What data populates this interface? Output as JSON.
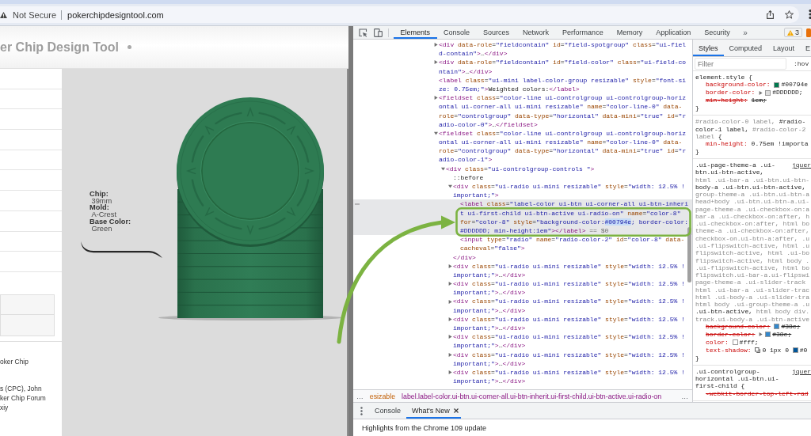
{
  "browser": {
    "security_label": "Not Secure",
    "url": "pokerchipdesigntool.com"
  },
  "page": {
    "title": "er Chip Design Tool",
    "spec": [
      {
        "label": "Chip:",
        "value": "39mm"
      },
      {
        "label": "Mold:",
        "value": "A-Crest"
      },
      {
        "label": "Base Color:",
        "value": "Green"
      }
    ],
    "credits": [
      "oker Chip",
      "s (CPC), John\nker Chip Forum\nxiy"
    ]
  },
  "devtools": {
    "tabs": [
      {
        "label": "Elements",
        "selected": true
      },
      {
        "label": "Console",
        "selected": false
      },
      {
        "label": "Sources",
        "selected": false
      },
      {
        "label": "Network",
        "selected": false
      },
      {
        "label": "Performance",
        "selected": false
      },
      {
        "label": "Memory",
        "selected": false
      },
      {
        "label": "Application",
        "selected": false
      },
      {
        "label": "Security",
        "selected": false
      }
    ],
    "more_tabs": "»",
    "issues_count": "3",
    "elements": {
      "tree": [
        {
          "lines": [
            "<div data-role=\"fieldcontain\" id=\"field-spotgroup\" class=\"ui-fiel",
            "d-contain\">…</div>"
          ],
          "expanded": false,
          "selected": false
        },
        {
          "lines": [
            "<div data-role=\"fieldcontain\" id=\"field-color\" class=\"ui-field-co",
            "ntain\">…</div>"
          ],
          "expanded": false,
          "selected": false
        },
        {
          "lines": [
            "<label class=\"ui-mini label-color-group resizable\" style=\"font-si",
            "ze: 0.75em;\">Weighted colors:</label>"
          ],
          "selected": false
        },
        {
          "lines": [
            "<fieldset class=\"color-line ui-controlgroup ui-controlgroup-horiz",
            "ontal ui-corner-all ui-mini resizable\" name=\"color-line-0\" data-",
            "role=\"controlgroup\" data-type=\"horizontal\" data-mini=\"true\" id=\"r",
            "adio-color-0\">…</fieldset>"
          ],
          "expanded": false,
          "selected": false
        },
        {
          "lines": [
            "<fieldset class=\"color-line ui-controlgroup ui-controlgroup-horiz",
            "ontal ui-corner-all ui-mini resizable\" name=\"color-line-0\" data-",
            "role=\"controlgroup\" data-type=\"horizontal\" data-mini=\"true\" id=\"r",
            "adio-color-1\">"
          ],
          "expanded": true,
          "selected": false,
          "children": [
            {
              "lines": [
                "<div class=\"ui-controlgroup-controls \">"
              ],
              "expanded": true,
              "selected": false,
              "children": [
                {
                  "lines": [
                    "::before"
                  ],
                  "selected": false
                },
                {
                  "lines": [
                    "<div class=\"ui-radio ui-mini resizable\" style=\"width: 12.5% !",
                    "important;\">"
                  ],
                  "expanded": true,
                  "selected": false,
                  "closing": "</div>",
                  "children": [
                    {
                      "lines": [
                        "<label class=\"label-color ui-btn ui-corner-all ui-btn-inheri",
                        "t ui-first-child ui-btn-active ui-radio-on\" name=\"color-8\"",
                        {
                          "before": "for=\"color-8\" style=\"background-color:",
                          "selection": "#00794e",
                          "after": "; border-color:"
                        },
                        "#DDDDDD; min-height:1em\"></label>"
                      ],
                      "suffix": "== $0",
                      "selected": true
                    },
                    {
                      "lines": [
                        "<input type=\"radio\" name=\"radio-color-2\" id=\"color-8\" data-",
                        "cacheval=\"false\">"
                      ],
                      "selected": false
                    }
                  ]
                },
                {
                  "lines": [
                    "<div class=\"ui-radio ui-mini resizable\" style=\"width: 12.5% !",
                    "important;\">…</div>"
                  ],
                  "expanded": false,
                  "selected": false
                },
                {
                  "lines": [
                    "<div class=\"ui-radio ui-mini resizable\" style=\"width: 12.5% !",
                    "important;\">…</div>"
                  ],
                  "expanded": false,
                  "selected": false
                },
                {
                  "lines": [
                    "<div class=\"ui-radio ui-mini resizable\" style=\"width: 12.5% !",
                    "important;\">…</div>"
                  ],
                  "expanded": false,
                  "selected": false
                },
                {
                  "lines": [
                    "<div class=\"ui-radio ui-mini resizable\" style=\"width: 12.5% !",
                    "important;\">…</div>"
                  ],
                  "expanded": false,
                  "selected": false
                },
                {
                  "lines": [
                    "<div class=\"ui-radio ui-mini resizable\" style=\"width: 12.5% !",
                    "important;\">…</div>"
                  ],
                  "expanded": false,
                  "selected": false
                },
                {
                  "lines": [
                    "<div class=\"ui-radio ui-mini resizable\" style=\"width: 12.5% !",
                    "important;\">…</div>"
                  ],
                  "expanded": false,
                  "selected": false
                },
                {
                  "lines": [
                    "<div class=\"ui-radio ui-mini resizable\" style=\"width: 12.5% !",
                    "important;\">…</div>"
                  ],
                  "expanded": false,
                  "selected": false
                }
              ]
            }
          ]
        }
      ]
    },
    "breadcrumbs": {
      "scroll_left": "…",
      "items": [
        {
          "text": "esizable",
          "selected": false
        },
        {
          "text": "label.label-color.ui-btn.ui-corner-all.ui-btn-inherit.ui-first-child.ui-btn-active.ui-radio-on",
          "selected": true
        }
      ],
      "scroll_right": "…"
    },
    "styles": {
      "tabs": [
        {
          "label": "Styles",
          "selected": true
        },
        {
          "label": "Computed",
          "selected": false
        },
        {
          "label": "Layout",
          "selected": false
        },
        {
          "label": "E",
          "selected": false
        }
      ],
      "filter": {
        "placeholder": "Filter"
      },
      "state_toggle": ":hov",
      "rules": [
        {
          "selector_lines": [
            [
              {
                "text": "element.style {",
                "matched": true
              }
            ]
          ],
          "declarations": [
            {
              "name": "background-color:",
              "kind": "color",
              "color": "#00794e",
              "value": "#00794e",
              "struck": false
            },
            {
              "name": "border-color:",
              "kind": "color",
              "expanded": false,
              "color": "#dddddd",
              "value": "#DDDDDD;",
              "struck": false
            },
            {
              "name": "min-height:",
              "kind": "plain",
              "value": "1em;",
              "struck": true
            }
          ],
          "closing": "}"
        },
        {
          "selector_lines": [
            [
              {
                "text": "#radio-color-0 label,",
                "matched": false
              },
              {
                "text": " #radio-",
                "matched": true
              }
            ],
            [
              {
                "text": "color-1 label,",
                "matched": true
              },
              {
                "text": " #radio-color-2",
                "matched": false
              }
            ],
            [
              {
                "text": "label",
                "matched": false
              },
              {
                "text": " {",
                "matched": true
              }
            ]
          ],
          "declarations": [
            {
              "name": "min-height:",
              "kind": "plain",
              "value": "0.75em !importa",
              "struck": false
            }
          ],
          "closing": "}"
        },
        {
          "selector_lines": [
            [
              {
                "text": ".ui-page-theme-a .ui-",
                "matched": true
              }
            ],
            [
              {
                "text": "btn.ui-btn-active,",
                "matched": true
              }
            ],
            [
              {
                "text": "html .ui-bar-a .ui-btn.ui-btn-",
                "matched": false
              }
            ],
            [
              {
                "text": "body-a .ui-btn.ui-btn-active,",
                "matched": true
              }
            ],
            [
              {
                "text": "group-theme-a .ui-btn.ui-btn-a",
                "matched": false
              }
            ],
            [
              {
                "text": "head+body .ui-btn.ui-btn-a.ui-",
                "matched": false
              }
            ],
            [
              {
                "text": "page-theme-a .ui-checkbox-on:a",
                "matched": false
              }
            ],
            [
              {
                "text": "bar-a .ui-checkbox-on:after, h",
                "matched": false
              }
            ],
            [
              {
                "text": ".ui-checkbox-on:after, html bo",
                "matched": false
              }
            ],
            [
              {
                "text": "theme-a .ui-checkbox-on:after,",
                "matched": false
              }
            ],
            [
              {
                "text": "checkbox-on.ui-btn-a:after, .u",
                "matched": false
              }
            ],
            [
              {
                "text": ".ui-flipswitch-active, html .u",
                "matched": false
              }
            ],
            [
              {
                "text": "flipswitch-active, html .ui-bo",
                "matched": false
              }
            ],
            [
              {
                "text": "flipswitch-active, html body .",
                "matched": false
              }
            ],
            [
              {
                "text": ".ui-flipswitch-active, html bo",
                "matched": false
              }
            ],
            [
              {
                "text": "flipswitch.ui-bar-a.ui-flipswi",
                "matched": false
              }
            ],
            [
              {
                "text": "page-theme-a .ui-slider-track",
                "matched": false
              }
            ],
            [
              {
                "text": "html .ui-bar-a .ui-slider-trac",
                "matched": false
              }
            ],
            [
              {
                "text": "html .ui-body-a .ui-slider-tra",
                "matched": false
              }
            ],
            [
              {
                "text": "html body .ui-group-theme-a .u",
                "matched": false
              }
            ],
            [
              {
                "text": ".ui-btn-active,",
                "matched": true
              },
              {
                "text": " html body div.",
                "matched": false
              }
            ],
            [
              {
                "text": "track.ui-body-a .ui-btn-active",
                "matched": false
              }
            ]
          ],
          "source": "jquer",
          "declarations": [
            {
              "name": "background-color:",
              "kind": "color",
              "color": "#3388cc",
              "value": "#38c;",
              "struck": true
            },
            {
              "name": "border-color:",
              "kind": "color",
              "expanded": false,
              "color": "#3388cc",
              "value": "#38c;",
              "struck": true
            },
            {
              "name": "color:",
              "kind": "color",
              "color": "#ffffff",
              "value": "#fff;",
              "struck": false
            },
            {
              "name": "text-shadow:",
              "kind": "shadow",
              "value": "0 1px 0",
              "color": "#005599",
              "color_value": "#0",
              "struck": false
            }
          ],
          "closing": "}"
        },
        {
          "selector_lines": [
            [
              {
                "text": ".ui-controlgroup-",
                "matched": true
              }
            ],
            [
              {
                "text": "horizontal .ui-btn.ui-",
                "matched": true
              }
            ],
            [
              {
                "text": "first-child {",
                "matched": true
              }
            ]
          ],
          "source": "jquer",
          "declarations": [
            {
              "name": "-webkit-border-top-left-rad",
              "kind": "plain",
              "struck": true
            }
          ]
        }
      ]
    },
    "drawer": {
      "tabs": [
        {
          "label": "Console",
          "selected": false,
          "closable": false
        },
        {
          "label": "What's New",
          "selected": true,
          "closable": true
        }
      ],
      "heading": "Highlights from the Chrome 109 update"
    }
  }
}
